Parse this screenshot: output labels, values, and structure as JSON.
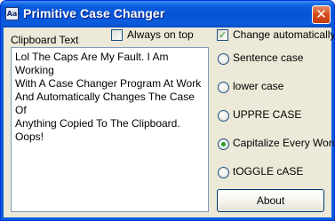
{
  "window": {
    "title": "Primitive Case Changer",
    "icon_label": "Aa",
    "close_glyph": "✕"
  },
  "clipboard": {
    "label": "Clipboard Text",
    "text": "Lol The Caps Are My Fault. I Am Working\nWith A Case Changer Program At Work\nAnd Automatically Changes The Case Of\nAnything Copied To The Clipboard. Oops!"
  },
  "options": {
    "always_on_top": {
      "label": "Always on top",
      "checked": false
    },
    "change_automatically": {
      "label": "Change automatically",
      "checked": true
    }
  },
  "cases": [
    {
      "label": "Sentence case",
      "selected": false
    },
    {
      "label": "lower case",
      "selected": false
    },
    {
      "label": "UPPRE CASE",
      "selected": false
    },
    {
      "label": "Capitalize Every Word",
      "selected": true
    },
    {
      "label": "tOGGLE cASE",
      "selected": false
    }
  ],
  "about_label": "About",
  "colors": {
    "titlebar": "#0a5ddd",
    "face": "#ece9d8",
    "check_green": "#21a121"
  }
}
